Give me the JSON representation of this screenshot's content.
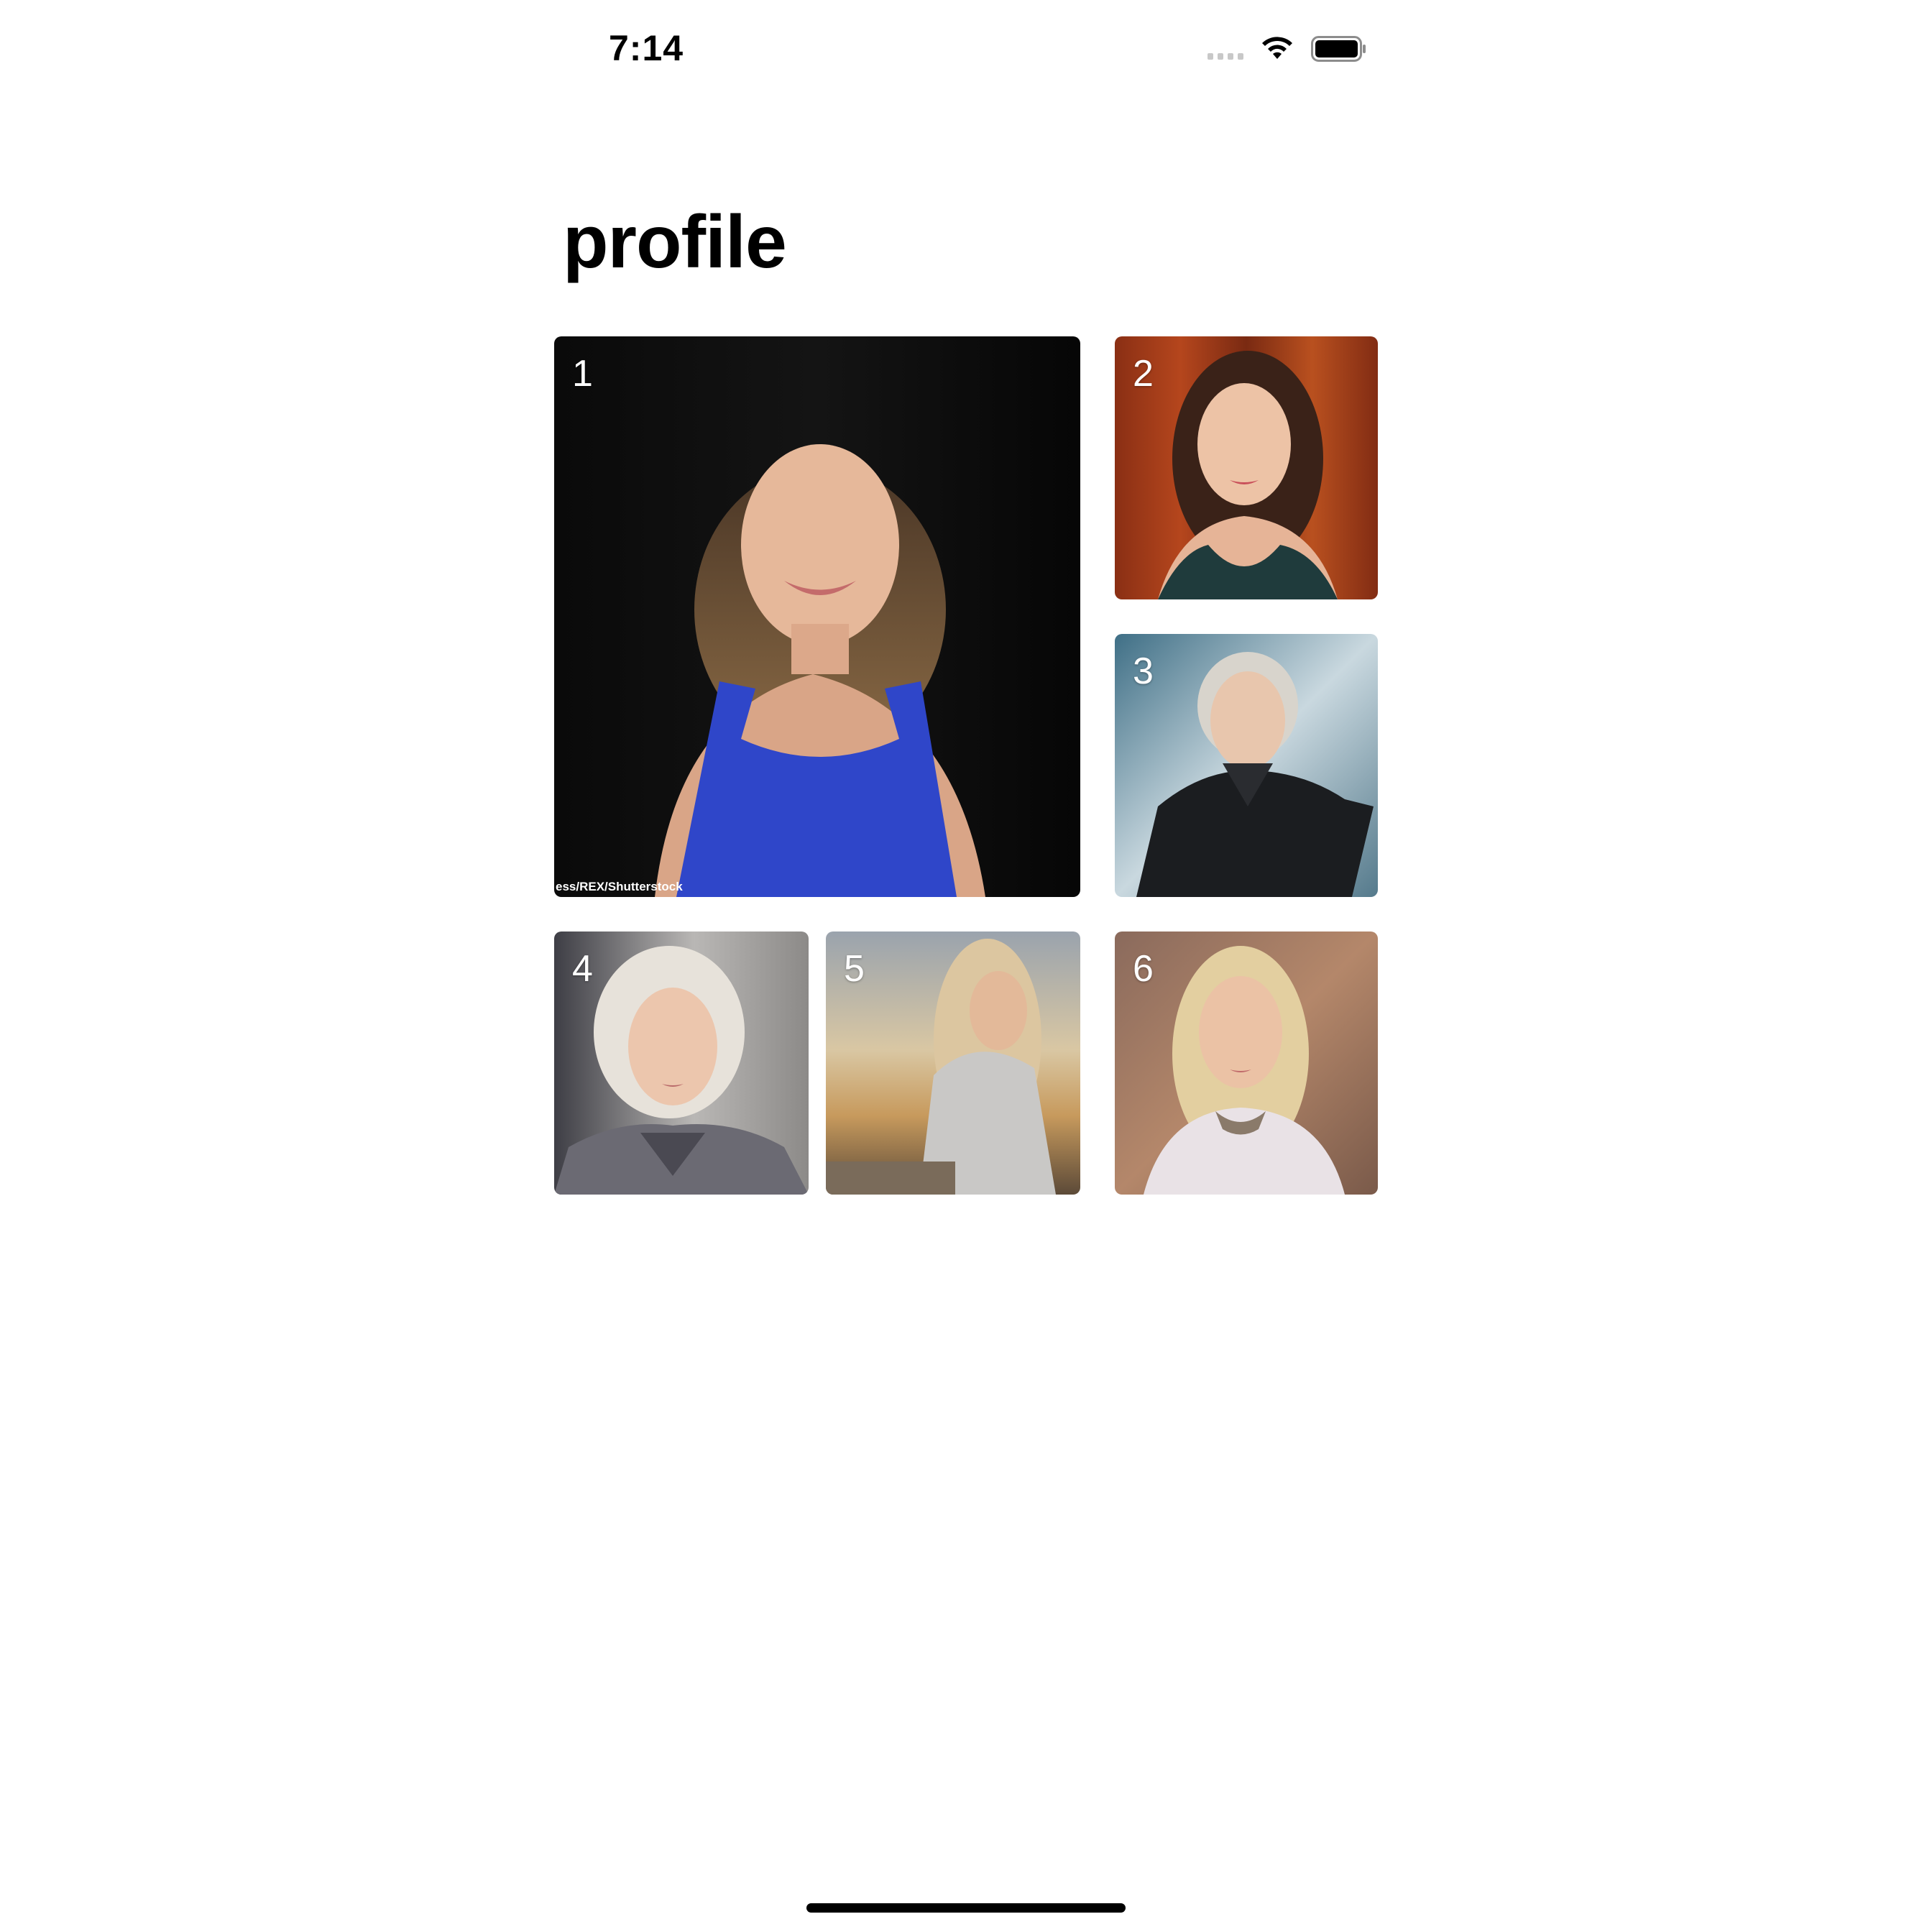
{
  "status_bar": {
    "time": "7:14",
    "icons": [
      "cellular-signal-icon",
      "wifi-icon",
      "battery-icon"
    ]
  },
  "page": {
    "title": "profile"
  },
  "photos": [
    {
      "number": "1",
      "credit": "ess/REX/Shutterstock"
    },
    {
      "number": "2"
    },
    {
      "number": "3"
    },
    {
      "number": "4"
    },
    {
      "number": "5"
    },
    {
      "number": "6"
    }
  ],
  "colors": {
    "background": "#ffffff",
    "title": "#000000",
    "photo_number": "#ffffff",
    "home_indicator": "#000000"
  }
}
